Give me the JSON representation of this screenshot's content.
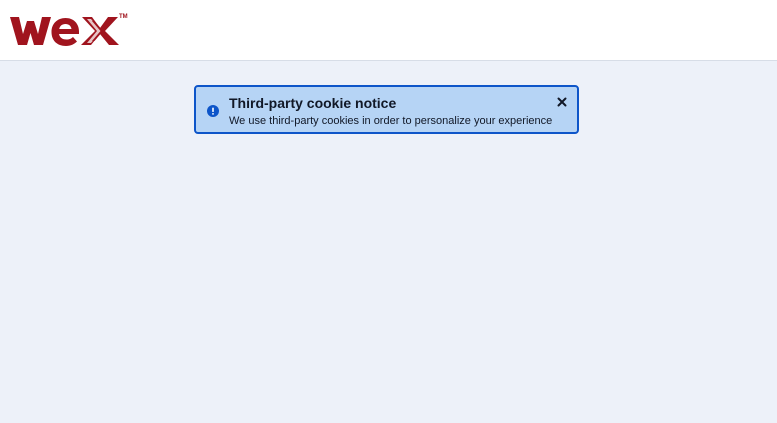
{
  "header": {
    "logo_text": "wex",
    "logo_trademark": "TM",
    "brand_color": "#a0141e"
  },
  "notice": {
    "title": "Third-party cookie notice",
    "message": "We use third-party cookies in order to personalize your experience",
    "icon": "info-icon",
    "close_icon": "close-icon",
    "accent_color": "#0d55c9",
    "background_color": "#b6d4f5"
  },
  "page": {
    "background_color": "#edf1f9"
  }
}
